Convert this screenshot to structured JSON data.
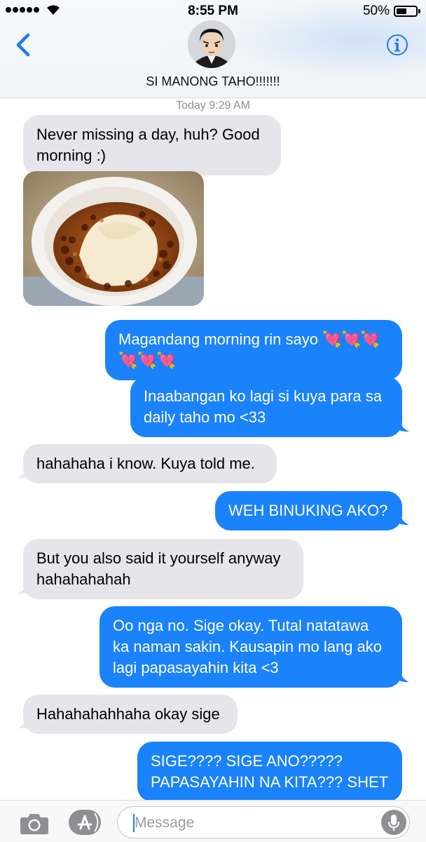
{
  "status_bar": {
    "time": "8:55 PM",
    "battery_percent": "50%",
    "battery_level": 0.5,
    "signal_bars": 5
  },
  "header": {
    "contact_name": "SI MANONG TAHO!!!!!!!",
    "back_icon": "chevron-left-icon",
    "info_icon": "info-icon",
    "accent_color": "#1a7cf5"
  },
  "conversation": {
    "timestamp_day": "Today",
    "timestamp_time": "9:29 AM",
    "messages": [
      {
        "from": "them",
        "text": "Never missing a day, huh? Good morning :)"
      },
      {
        "from": "them",
        "type": "photo",
        "subject": "taho-cup"
      },
      {
        "from": "me",
        "text": "Magandang morning rin sayo 💘💘💘💘💘💘"
      },
      {
        "from": "me",
        "text": "Inaabangan ko lagi si kuya para sa daily taho mo <33"
      },
      {
        "from": "them",
        "text": "hahahaha i know. Kuya told me."
      },
      {
        "from": "me",
        "text": "WEH BINUKING AKO?"
      },
      {
        "from": "them",
        "text": "But you also said it yourself anyway hahahahahah"
      },
      {
        "from": "me",
        "text": "Oo nga no. Sige okay. Tutal natatawa ka naman sakin. Kausapin mo lang ako lagi papasayahin kita <3"
      },
      {
        "from": "them",
        "text": "Hahahahahhaha okay sige"
      },
      {
        "from": "me",
        "text": "SIGE???? SIGE ANO????? PAPASAYAHIN NA KITA??? SHET"
      }
    ]
  },
  "composer": {
    "placeholder": "Message",
    "value": "",
    "camera_icon": "camera-icon",
    "apps_icon": "app-store-icon",
    "mic_icon": "microphone-icon"
  },
  "colors": {
    "sent_bubble": "#1a82fb",
    "received_bubble": "#e5e5ea",
    "timestamp_text": "#8e8e93"
  }
}
